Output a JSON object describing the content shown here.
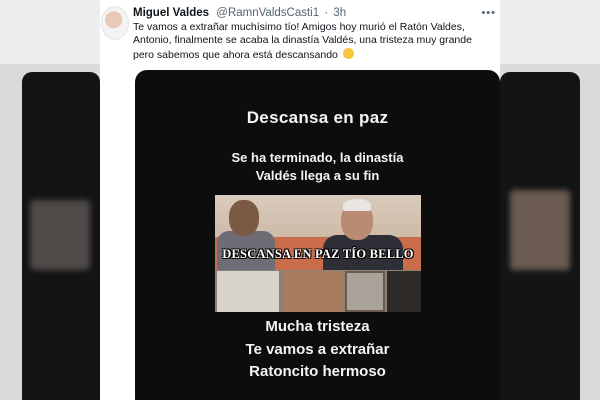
{
  "tweet": {
    "display_name": "Miguel Valdes",
    "handle": "@RamnValdsCasti1",
    "separator": "·",
    "time": "3h",
    "more_icon": "more-horizontal-icon",
    "text": "Te vamos a extrañar muchísimo tío! Amigos hoy murió el Ratón Valdes, Antonio, finalmente se acaba la dinastía Valdés, una tristeza muy grande pero sabemos que ahora está descansando",
    "emoji": "slightly-smiling-face"
  },
  "media": {
    "title": "Descansa en paz",
    "line1": "Se ha terminado, la dinastía",
    "line2": "Valdés llega a su fin",
    "photo_caption": "DESCANSA EN PAZ TÍO BELLO",
    "bottom_line1": "Mucha tristeza",
    "bottom_line2": "Te vamos a extrañar",
    "bottom_line3": "Ratoncito hermoso"
  },
  "colors": {
    "text_primary": "#0f1419",
    "text_secondary": "#536471",
    "media_background": "#0d0d0d",
    "media_text": "#f4f4f4"
  }
}
